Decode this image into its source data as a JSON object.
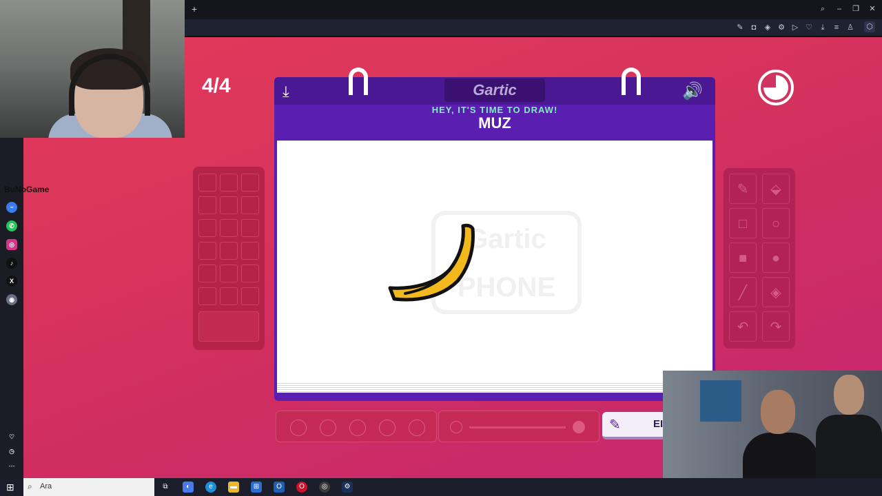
{
  "webcam_overlay": {
    "channel_label": "BuNoGame"
  },
  "browser": {
    "toolbar_icons": [
      "search-icon",
      "minimize-icon",
      "restore-icon",
      "close-icon"
    ],
    "address_icons": [
      "snapshot-icon",
      "camera-icon",
      "shield-icon",
      "extension-icon",
      "play-icon",
      "heart-icon",
      "download-icon",
      "menu-icon",
      "profile-icon",
      "settings-icon"
    ]
  },
  "sidebar": {
    "items": [
      "messenger-icon",
      "whatsapp-icon",
      "instagram-icon",
      "tiktok-icon",
      "x-icon",
      "player-icon"
    ],
    "bottom_items": [
      "heart-icon",
      "history-icon",
      "more-icon"
    ]
  },
  "game": {
    "round": "4/4",
    "logo": "Gartic",
    "prompt": "HEY, IT'S TIME TO DRAW!",
    "word": "MUZ",
    "watermark": "Gartic PHONE",
    "timer_fraction_elapsed": 0.75,
    "done_button_label": "EI",
    "brush_sizes": 5,
    "tools": [
      "pencil-icon",
      "eraser-icon",
      "rect-outline-icon",
      "circle-outline-icon",
      "rect-fill-icon",
      "circle-fill-icon",
      "line-icon",
      "fill-bucket-icon",
      "undo-icon",
      "redo-icon"
    ],
    "colors": {
      "background": "#d8345c",
      "header": "#5a1fb0",
      "banana_fill": "#f2b81c",
      "banana_outline": "#111111",
      "prompt_text": "#7ef0c0"
    }
  },
  "taskbar": {
    "search_placeholder": "Ara"
  }
}
